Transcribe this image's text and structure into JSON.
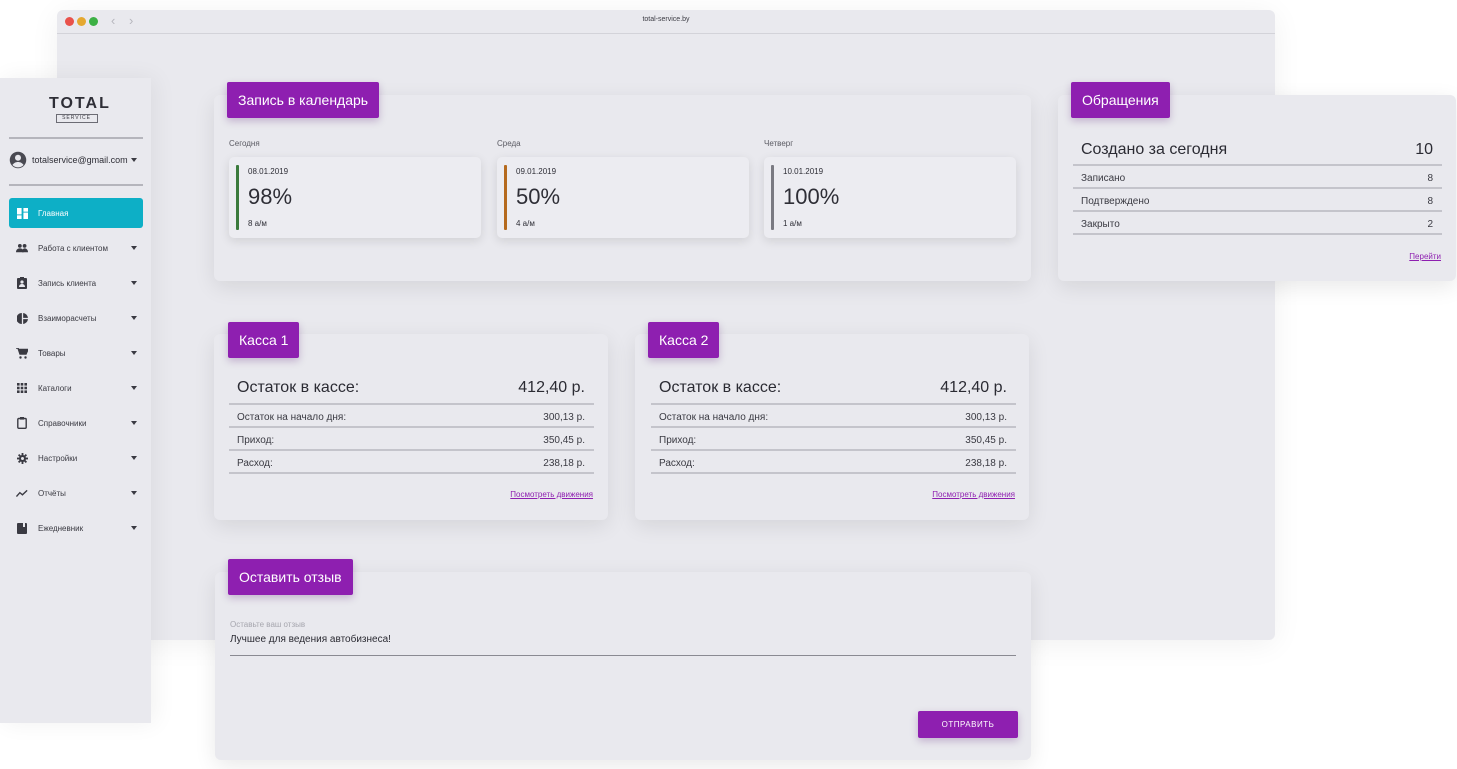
{
  "browser": {
    "url": "total-service.by"
  },
  "logo": {
    "main": "TOTAL",
    "sub": "SERVICE"
  },
  "account": {
    "email": "totalservice@gmail.com"
  },
  "sidebar": {
    "items": [
      {
        "label": "Главная",
        "icon": "dashboard-icon",
        "active": true
      },
      {
        "label": "Работа с клиентом",
        "icon": "people-icon"
      },
      {
        "label": "Запись клиента",
        "icon": "clipboard-icon"
      },
      {
        "label": "Взаиморасчеты",
        "icon": "pie-chart-icon"
      },
      {
        "label": "Товары",
        "icon": "cart-icon"
      },
      {
        "label": "Каталоги",
        "icon": "grid-icon"
      },
      {
        "label": "Справочники",
        "icon": "clipboard-outline-icon"
      },
      {
        "label": "Настройки",
        "icon": "gear-icon"
      },
      {
        "label": "Отчёты",
        "icon": "trend-icon"
      },
      {
        "label": "Ежедневник",
        "icon": "book-icon"
      }
    ]
  },
  "calendar": {
    "title": "Запись в календарь",
    "days": [
      {
        "label": "Сегодня",
        "date": "08.01.2019",
        "percent": "98%",
        "count": "8 а/м",
        "color": "#3a7a3c"
      },
      {
        "label": "Среда",
        "date": "09.01.2019",
        "percent": "50%",
        "count": "4 а/м",
        "color": "#b56a1e"
      },
      {
        "label": "Четверг",
        "date": "10.01.2019",
        "percent": "100%",
        "count": "1 а/м",
        "color": "#7a7a82"
      }
    ]
  },
  "requests": {
    "title": "Обращения",
    "head": {
      "label": "Создано за сегодня",
      "value": "10"
    },
    "rows": [
      {
        "label": "Записано",
        "value": "8"
      },
      {
        "label": "Подтверждено",
        "value": "8"
      },
      {
        "label": "Закрыто",
        "value": "2"
      }
    ],
    "link": "Перейти"
  },
  "cash": [
    {
      "title": "Касса 1",
      "head": {
        "label": "Остаток в кассе:",
        "value": "412,40 р."
      },
      "rows": [
        {
          "label": "Остаток на начало дня:",
          "value": "300,13 р."
        },
        {
          "label": "Приход:",
          "value": "350,45 р."
        },
        {
          "label": "Расход:",
          "value": "238,18 р."
        }
      ],
      "link": "Посмотреть движения"
    },
    {
      "title": "Касса 2",
      "head": {
        "label": "Остаток в кассе:",
        "value": "412,40 р."
      },
      "rows": [
        {
          "label": "Остаток на начало дня:",
          "value": "300,13 р."
        },
        {
          "label": "Приход:",
          "value": "350,45 р."
        },
        {
          "label": "Расход:",
          "value": "238,18 р."
        }
      ],
      "link": "Посмотреть движения"
    }
  ],
  "feedback": {
    "title": "Оставить отзыв",
    "placeholder": "Оставьте ваш отзыв",
    "value": "Лучшее для ведения автобизнеса!",
    "button": "ОТПРАВИТЬ"
  },
  "colors": {
    "accent": "#8e1fb0",
    "active": "#0dafc6",
    "background": "#e9e9ee"
  }
}
